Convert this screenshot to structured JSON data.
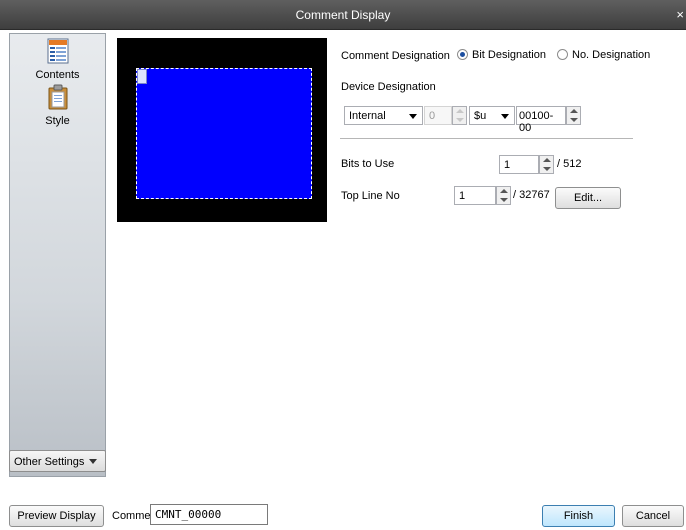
{
  "window": {
    "title": "Comment Display",
    "close_glyph": "×"
  },
  "sidebar": {
    "items": [
      {
        "label": "Contents",
        "icon": "contents-icon"
      },
      {
        "label": "Style",
        "icon": "style-icon"
      }
    ],
    "other_settings": "Other Settings"
  },
  "form": {
    "comment_designation_label": "Comment Designation",
    "bit_designation": "Bit Designation",
    "no_designation": "No. Designation",
    "device_designation_label": "Device Designation",
    "device_type": "Internal",
    "device_bank": "0",
    "device_prefix": "$u",
    "device_address": "00100-00",
    "bits_to_use_label": "Bits to Use",
    "bits_to_use_value": "1",
    "bits_to_use_max": "/ 512",
    "top_line_label": "Top Line No",
    "top_line_value": "1",
    "top_line_max": "/ 32767",
    "edit_button": "Edit..."
  },
  "footer": {
    "preview_button": "Preview Display",
    "comment_label": "Comme",
    "comment_value": "CMNT_00000",
    "finish_button": "Finish",
    "cancel_button": "Cancel"
  },
  "colors": {
    "preview_bg": "#000000",
    "screen_fill": "#0000ff",
    "titlebar": "#4a4a4a"
  }
}
